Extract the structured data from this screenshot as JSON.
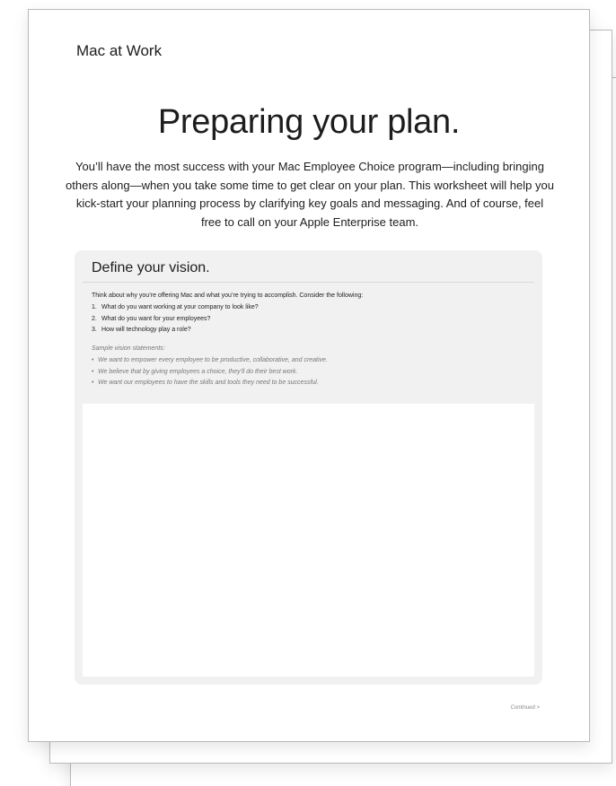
{
  "document": {
    "brand": "Mac at Work",
    "headline": "Preparing your plan.",
    "intro": "You’ll have the most success with your Mac Employee Choice program—including bringing others along—when you take some time to get clear on your plan. This worksheet will help you kick-start your planning process by clarifying key goals and messaging. And of course, feel free to call on your Apple Enterprise team.",
    "section": {
      "title": "Define your vision.",
      "prompt": "Think about why you’re offering Mac and what you’re trying to accomplish. Consider the following:",
      "questions": [
        {
          "num": "1.",
          "text": "What do you want working at your company to look like?"
        },
        {
          "num": "2.",
          "text": "What do you want for your employees?"
        },
        {
          "num": "3.",
          "text": "How will technology play a role?"
        }
      ],
      "sample_title": "Sample vision statements:",
      "samples": [
        {
          "bullet": "•",
          "text": "We want to empower every employee to be productive, collaborative, and creative."
        },
        {
          "bullet": "•",
          "text": "We believe that by giving employees a choice, they’ll do their best work."
        },
        {
          "bullet": "•",
          "text": "We want our employees to have the skills and tools they need to be successful."
        }
      ],
      "answer_value": ""
    },
    "continued": "Continued >"
  }
}
